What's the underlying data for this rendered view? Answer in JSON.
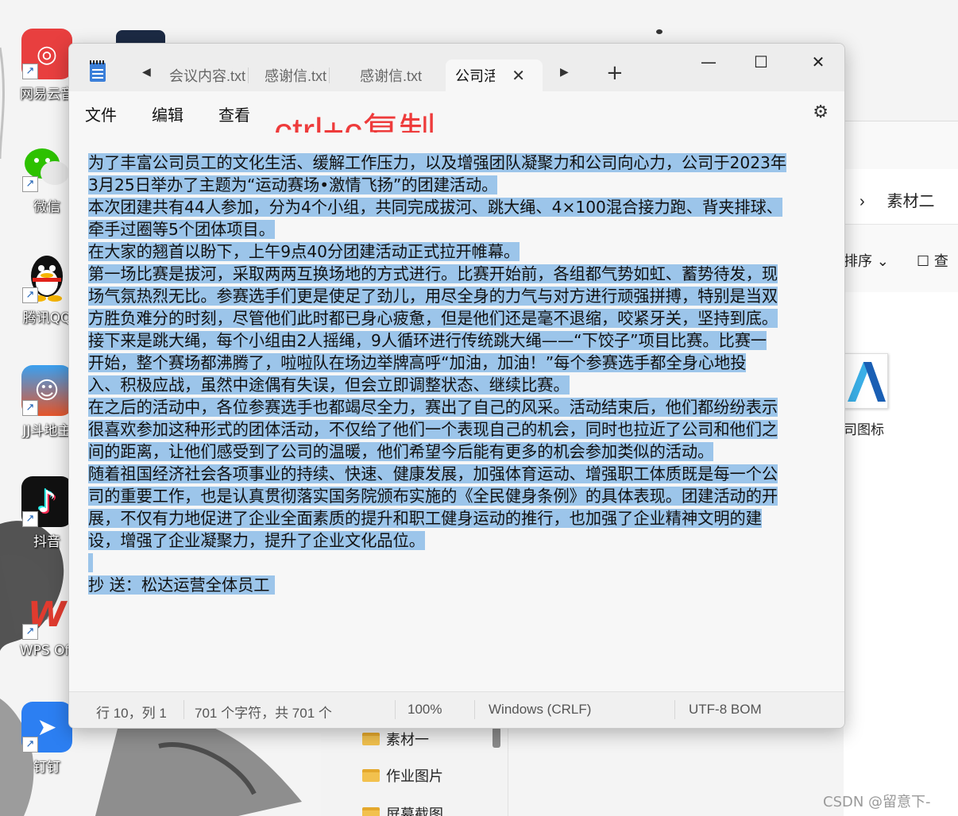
{
  "desktop": {
    "icons": [
      {
        "name": "wangyi-icon",
        "label": "网易云音",
        "glyph": "◎",
        "color": "#e83f3f"
      },
      {
        "name": "wechat-icon",
        "label": "微信",
        "glyph": "●",
        "color": "#2dc100"
      },
      {
        "name": "qq-icon",
        "label": "腾讯QQ",
        "glyph": "●",
        "color": "#111111"
      },
      {
        "name": "ddz-icon",
        "label": "JJ斗地主",
        "glyph": "☺",
        "color": "#e5552a"
      },
      {
        "name": "douyin-icon",
        "label": "抖音",
        "glyph": "♪",
        "color": "#111111"
      },
      {
        "name": "wps-icon",
        "label": "WPS Off",
        "glyph": "W",
        "color": "#e03b2f"
      },
      {
        "name": "dingding-icon",
        "label": "钉钉",
        "glyph": "➤",
        "color": "#2c7ff2"
      }
    ],
    "watermark": "CSDN @留意下-"
  },
  "explorer": {
    "breadcrumb_sep": "›",
    "breadcrumb": "素材二",
    "sort_label": "排序 ⌄",
    "view_label": "☐ 查",
    "file_label": "司图标",
    "nav_items": [
      "素材一",
      "作业图片",
      "屏幕截图"
    ]
  },
  "notepad": {
    "tabs": [
      "会议内容.txt",
      "感谢信.txt",
      "感谢信.txt"
    ],
    "active_tab": "公司活动.txt",
    "close_glyph": "✕",
    "new_tab_glyph": "+",
    "tab_prev": "◀",
    "tab_next": "▶",
    "window_buttons": {
      "minimize": "—",
      "maximize": "☐",
      "close": "✕"
    },
    "menu": {
      "file": "文件",
      "edit": "编辑",
      "view": "查看"
    },
    "settings_glyph": "⚙",
    "annotation": "ctrl+c复制",
    "lines": [
      "为了丰富公司员工的文化生活、缓解工作压力，以及增强团队凝聚力和公司向心力，公司于2023年",
      "3月25日举办了主题为“运动赛场•激情飞扬”的团建活动。",
      "本次团建共有44人参加，分为4个小组，共同完成拔河、跳大绳、4×100混合接力跑、背夹排球、",
      "牵手过圈等5个团体项目。",
      "在大家的翘首以盼下，上午9点40分团建活动正式拉开帷幕。",
      "第一场比赛是拔河，采取两两互换场地的方式进行。比赛开始前，各组都气势如虹、蓄势待发，现",
      "场气氛热烈无比。参赛选手们更是使足了劲儿，用尽全身的力气与对方进行顽强拼搏，特别是当双",
      "方胜负难分的时刻，尽管他们此时都已身心疲惫，但是他们还是毫不退缩，咬紧牙关，坚持到底。",
      "接下来是跳大绳，每个小组由2人摇绳，9人循环进行传统跳大绳——“下饺子”项目比赛。比赛一",
      "开始，整个赛场都沸腾了，啦啦队在场边举牌高呼“加油，加油！”每个参赛选手都全身心地投",
      "入、积极应战，虽然中途偶有失误，但会立即调整状态、继续比赛。",
      "在之后的活动中，各位参赛选手也都竭尽全力，赛出了自己的风采。活动结束后，他们都纷纷表示",
      "很喜欢参加这种形式的团体活动，不仅给了他们一个表现自己的机会，同时也拉近了公司和他们之",
      "间的距离，让他们感受到了公司的温暖，他们希望今后能有更多的机会参加类似的活动。",
      "随着祖国经济社会各项事业的持续、快速、健康发展，加强体育运动、增强职工体质既是每一个公",
      "司的重要工作，也是认真贯彻落实国务院颁布实施的《全民健身条例》的具体表现。团建活动的开",
      "展，不仅有力地促进了企业全面素质的提升和职工健身运动的推行，也加强了企业精神文明的建",
      "设，增强了企业凝聚力，提升了企业文化品位。",
      " ",
      "抄 送：松达运营全体员工 "
    ],
    "status": {
      "position": "行 10，列 1",
      "chars": "701 个字符，共 701 个",
      "zoom": "100%",
      "line_ending": "Windows (CRLF)",
      "encoding": "UTF-8 BOM"
    }
  }
}
